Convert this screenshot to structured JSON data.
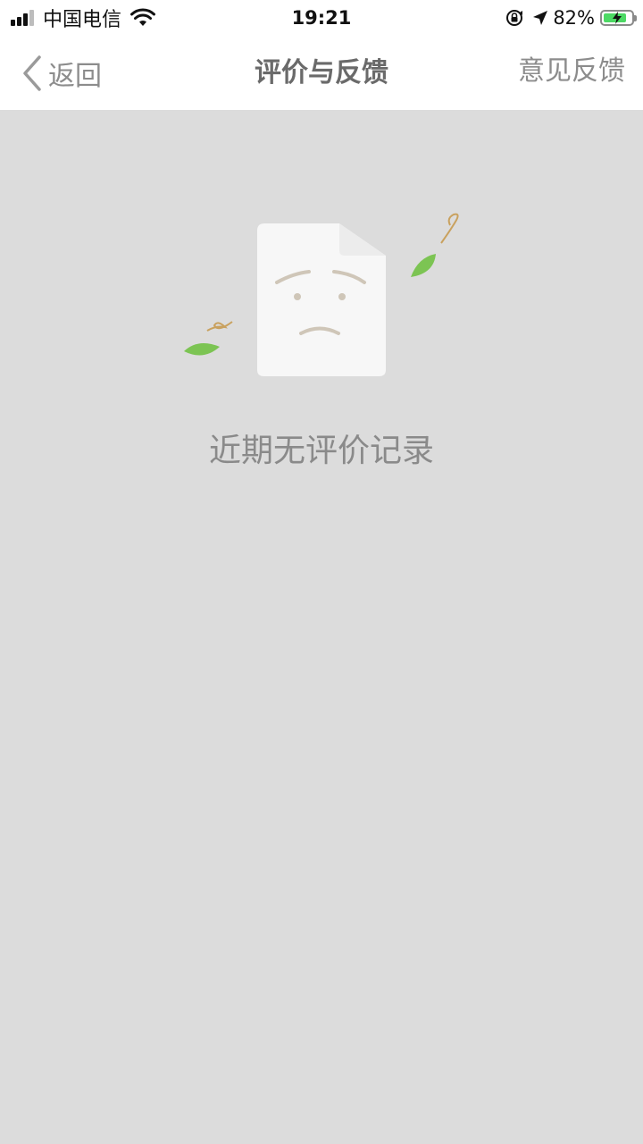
{
  "status_bar": {
    "carrier": "中国电信",
    "time": "19:21",
    "battery_percent": "82%",
    "battery_level": 0.82,
    "icons": [
      "signal-icon",
      "wifi-icon",
      "rotation-lock-icon",
      "location-icon",
      "battery-charging-icon"
    ]
  },
  "nav": {
    "back_label": "返回",
    "title": "评价与反馈",
    "right_action": "意见反馈",
    "back_icon": "chevron-left-icon"
  },
  "empty_state": {
    "illustration": "sad-document-icon",
    "message": "近期无评价记录"
  },
  "colors": {
    "background": "#dcdcdc",
    "nav_background": "#ffffff",
    "leaf": "#7cc453",
    "battery": "#4cd964"
  }
}
